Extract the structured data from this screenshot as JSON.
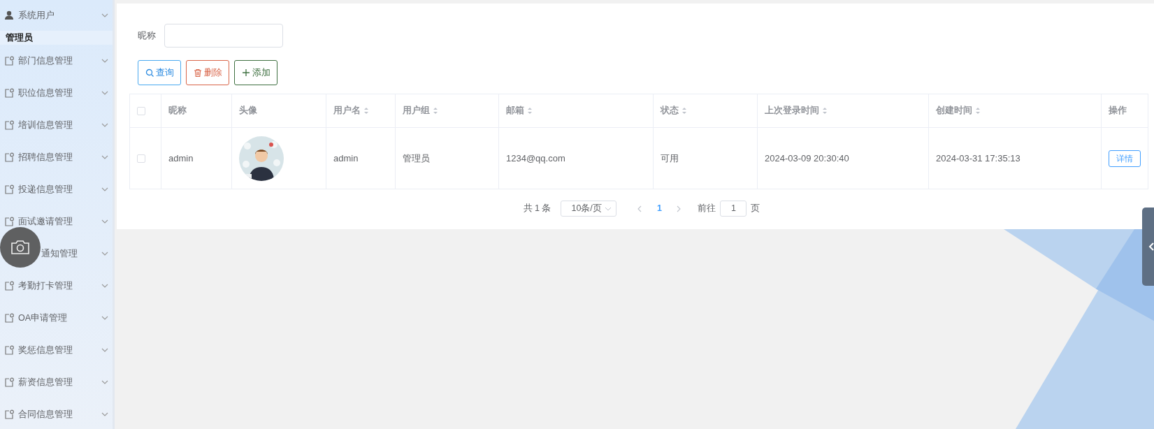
{
  "sidebar": {
    "items": [
      {
        "label": "系统用户",
        "kind": "user",
        "children": [
          {
            "label": "管理员"
          }
        ]
      },
      {
        "label": "部门信息管理",
        "kind": "module"
      },
      {
        "label": "职位信息管理",
        "kind": "module"
      },
      {
        "label": "培训信息管理",
        "kind": "module"
      },
      {
        "label": "招聘信息管理",
        "kind": "module"
      },
      {
        "label": "投递信息管理",
        "kind": "module"
      },
      {
        "label": "面试邀请管理",
        "kind": "module"
      },
      {
        "label": "通知管理",
        "partly_covered": true
      },
      {
        "label": "考勤打卡管理",
        "kind": "module"
      },
      {
        "label": "OA申请管理",
        "kind": "module"
      },
      {
        "label": "奖惩信息管理",
        "kind": "module"
      },
      {
        "label": "薪资信息管理",
        "kind": "module"
      },
      {
        "label": "合同信息管理",
        "kind": "module"
      }
    ]
  },
  "search": {
    "label": "昵称"
  },
  "toolbar": {
    "buttons": [
      {
        "label": "查询",
        "kind": "search"
      },
      {
        "label": "删除",
        "kind": "delete"
      },
      {
        "label": "添加",
        "kind": "add"
      }
    ]
  },
  "table": {
    "header_checked": false,
    "columns": [
      {
        "label": "昵称",
        "sortable": false
      },
      {
        "label": "头像",
        "sortable": false
      },
      {
        "label": "用户名",
        "sortable": true
      },
      {
        "label": "用户组",
        "sortable": true
      },
      {
        "label": "邮箱",
        "sortable": true
      },
      {
        "label": "状态",
        "sortable": true
      },
      {
        "label": "上次登录时间",
        "sortable": true
      },
      {
        "label": "创建时间",
        "sortable": true
      },
      {
        "label": "操作",
        "sortable": false
      }
    ],
    "rows": [
      {
        "checked": false,
        "cells": [
          {
            "kind": "text",
            "text": "admin"
          },
          {
            "kind": "picture"
          },
          {
            "kind": "text",
            "text": "admin"
          },
          {
            "kind": "text",
            "text": "管理员"
          },
          {
            "kind": "text",
            "text": "1234@qq.com"
          },
          {
            "kind": "text",
            "text": "可用"
          },
          {
            "kind": "text",
            "text": "2024-03-09 20:30:40"
          },
          {
            "kind": "text",
            "text": "2024-03-31 17:35:13"
          },
          {
            "kind": "button",
            "text": "详情"
          }
        ]
      }
    ]
  },
  "pagination": {
    "total": "共 1 条",
    "page_size": "10条/页",
    "pages": [
      {
        "label": "1",
        "selected": true
      }
    ],
    "goto_label": "前往",
    "goto_value": "1",
    "goto_suffix": "页"
  }
}
